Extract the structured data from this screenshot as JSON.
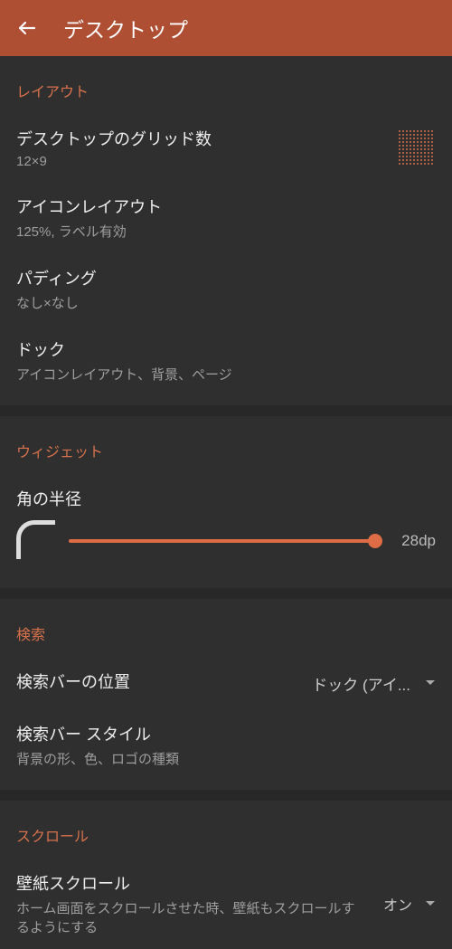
{
  "header": {
    "title": "デスクトップ"
  },
  "sections": {
    "layout": {
      "header": "レイアウト",
      "grid": {
        "title": "デスクトップのグリッド数",
        "sub": "12×9"
      },
      "icon_layout": {
        "title": "アイコンレイアウト",
        "sub": "125%, ラベル有効"
      },
      "padding": {
        "title": "パディング",
        "sub": "なし×なし"
      },
      "dock": {
        "title": "ドック",
        "sub": "アイコンレイアウト、背景、ページ"
      }
    },
    "widget": {
      "header": "ウィジェット",
      "corner": {
        "title": "角の半径",
        "value": "28dp"
      }
    },
    "search": {
      "header": "検索",
      "position": {
        "title": "検索バーの位置",
        "value": "ドック (アイ..."
      },
      "style": {
        "title": "検索バー スタイル",
        "sub": "背景の形、色、ロゴの種類"
      }
    },
    "scroll": {
      "header": "スクロール",
      "wallpaper": {
        "title": "壁紙スクロール",
        "sub": "ホーム画面をスクロールさせた時、壁紙もスクロールするようにする",
        "value": "オン"
      }
    }
  }
}
